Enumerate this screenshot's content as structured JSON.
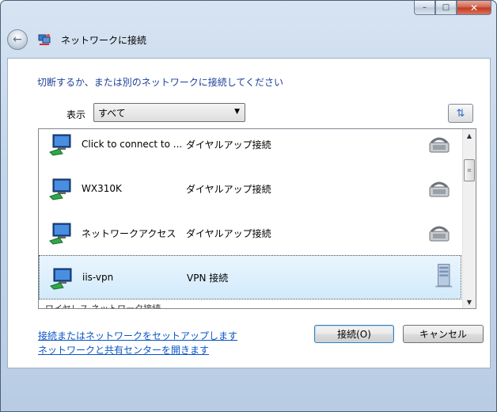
{
  "window": {
    "title": "ネットワークに接続",
    "caption": {
      "minimize": "–",
      "maximize": "□",
      "close": "✕"
    }
  },
  "instruction": "切断するか、または別のネットワークに接続してください",
  "show": {
    "label": "表示",
    "selected": "すべて"
  },
  "connections": [
    {
      "name": "Click to connect to ...",
      "type": "ダイヤルアップ接続",
      "type_icon": "phone-modem-icon",
      "selected": false
    },
    {
      "name": "WX310K",
      "type": "ダイヤルアップ接続",
      "type_icon": "phone-modem-icon",
      "selected": false
    },
    {
      "name": "ネットワークアクセス",
      "type": "ダイヤルアップ接続",
      "type_icon": "phone-modem-icon",
      "selected": false
    },
    {
      "name": "iis-vpn",
      "type": "VPN 接続",
      "type_icon": "server-icon",
      "selected": true
    }
  ],
  "group_peek": "ワイヤレス ネットワーク接続",
  "links": {
    "setup": "接続またはネットワークをセットアップします",
    "sharing_center": "ネットワークと共有センターを開きます"
  },
  "buttons": {
    "connect": "接続(O)",
    "cancel": "キャンセル"
  },
  "colors": {
    "instruction": "#1c3e99",
    "link": "#0a55c4",
    "selection": "#d2eafb"
  }
}
